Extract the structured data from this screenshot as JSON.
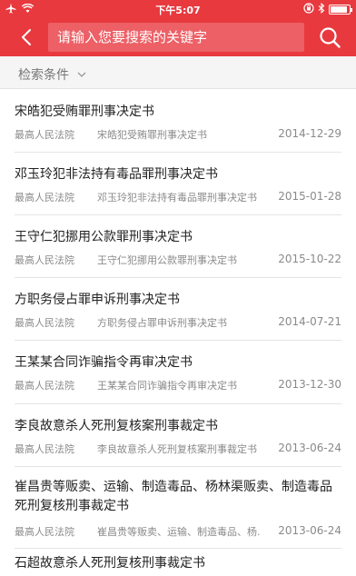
{
  "status_bar": {
    "time": "下午5:07"
  },
  "header": {
    "back_icon": "chevron-left-icon",
    "search_placeholder": "请输入您要搜索的关键字",
    "search_icon": "search-icon",
    "accent": "#e8393f"
  },
  "filter": {
    "label": "检索条件",
    "icon": "chevron-down-icon"
  },
  "results": [
    {
      "title": "宋皓犯受贿罪刑事决定书",
      "court": "最高人民法院",
      "summary": "宋皓犯受贿罪刑事决定书",
      "date": "2014-12-29"
    },
    {
      "title": "邓玉玲犯非法持有毒品罪刑事决定书",
      "court": "最高人民法院",
      "summary": "邓玉玲犯非法持有毒品罪刑事决定书",
      "date": "2015-01-28"
    },
    {
      "title": "王守仁犯挪用公款罪刑事决定书",
      "court": "最高人民法院",
      "summary": "王守仁犯挪用公款罪刑事决定书",
      "date": "2015-10-22"
    },
    {
      "title": "方职务侵占罪申诉刑事决定书",
      "court": "最高人民法院",
      "summary": "方职务侵占罪申诉刑事决定书",
      "date": "2014-07-21"
    },
    {
      "title": "王某某合同诈骗指令再审决定书",
      "court": "最高人民法院",
      "summary": "王某某合同诈骗指令再审决定书",
      "date": "2013-12-30"
    },
    {
      "title": "李良故意杀人死刑复核案刑事裁定书",
      "court": "最高人民法院",
      "summary": "李良故意杀人死刑复核案刑事裁定书",
      "date": "2013-06-24"
    },
    {
      "title": "崔昌贵等贩卖、运输、制造毒品、杨林渠贩卖、制造毒品死刑复核刑事裁定书",
      "court": "最高人民法院",
      "summary": "崔昌贵等贩卖、运输、制造毒品、杨...",
      "date": "2013-06-24"
    },
    {
      "title": "石超故意杀人死刑复核刑事裁定书",
      "court": "",
      "summary": "",
      "date": ""
    }
  ]
}
